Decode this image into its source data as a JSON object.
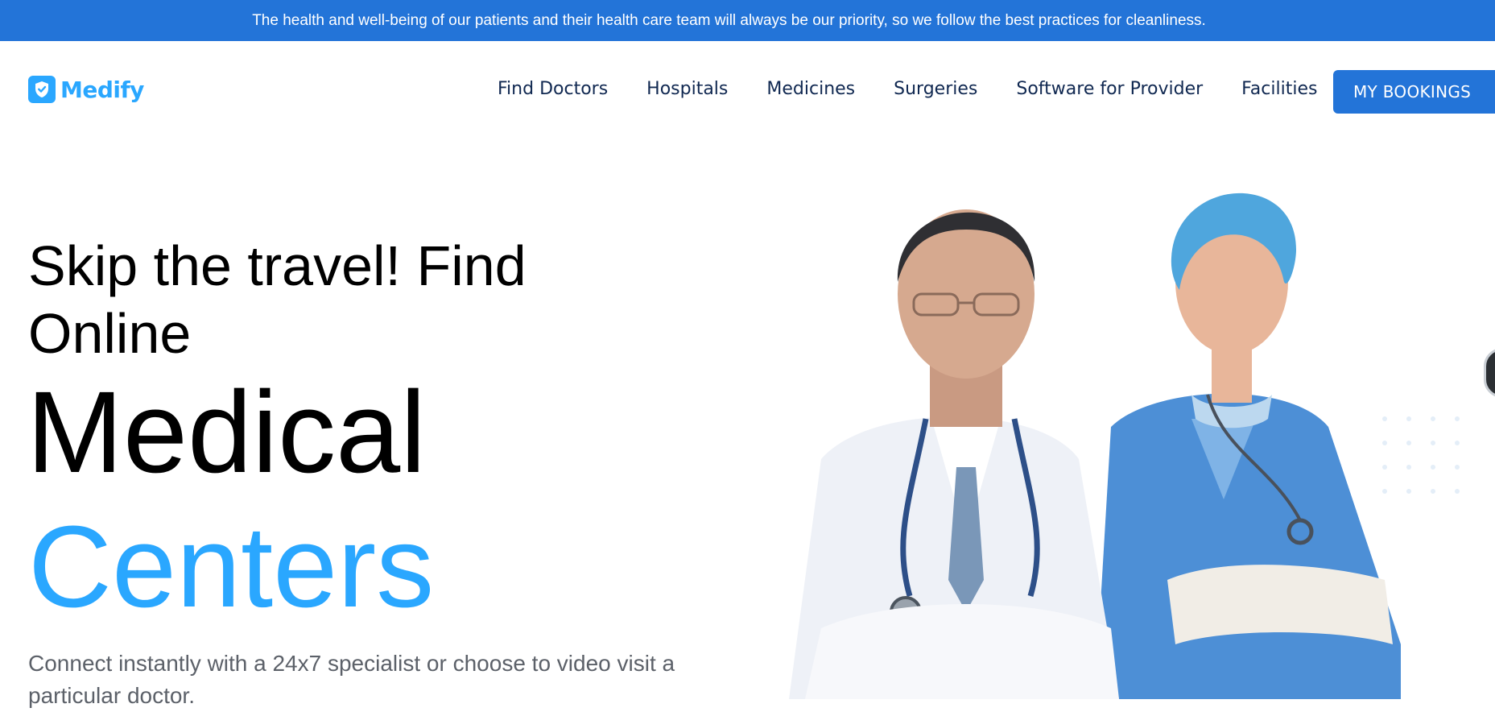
{
  "banner": {
    "text": "The health and well-being of our patients and their health care team will always be our priority, so we follow the best practices for cleanliness."
  },
  "brand": {
    "name": "Medify",
    "logo_icon": "shield-check-icon",
    "color": "#2aa7ff"
  },
  "nav": {
    "items": [
      {
        "label": "Find Doctors"
      },
      {
        "label": "Hospitals"
      },
      {
        "label": "Medicines"
      },
      {
        "label": "Surgeries"
      },
      {
        "label": "Software for Provider"
      },
      {
        "label": "Facilities"
      }
    ],
    "cta_label": "MY BOOKINGS"
  },
  "hero": {
    "subtitle": "Skip the travel! Find Online",
    "title_line1": "Medical",
    "title_line2": "Centers",
    "description": "Connect instantly with a 24x7 specialist or choose to video visit a particular doctor.",
    "image": "doctor-and-nurse-photo"
  },
  "colors": {
    "primary": "#2374d8",
    "accent": "#2aa7ff",
    "nav_text": "#102851",
    "body_text": "#5c6169"
  }
}
